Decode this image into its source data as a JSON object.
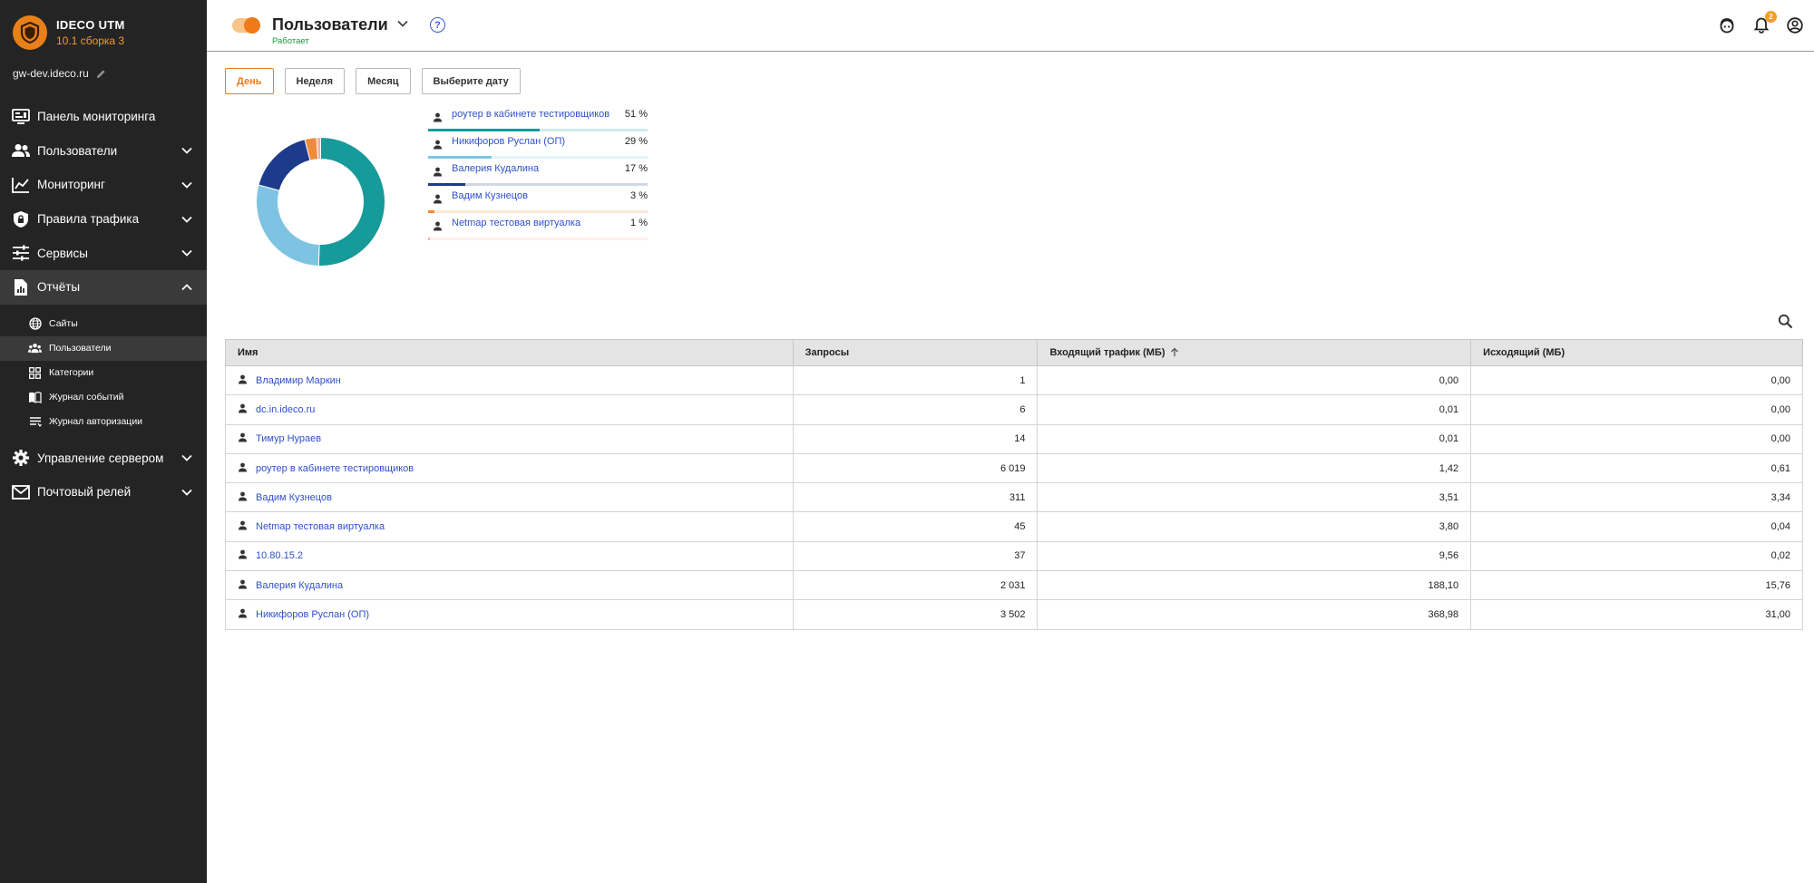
{
  "app": {
    "name": "IDECO UTM",
    "version": "10.1 сборка 3",
    "host": "gw-dev.ideco.ru"
  },
  "nav": {
    "items": [
      {
        "label": "Панель мониторинга",
        "icon": "monitoring-panel-icon"
      },
      {
        "label": "Пользователи",
        "icon": "users-icon"
      },
      {
        "label": "Мониторинг",
        "icon": "chart-line-icon"
      },
      {
        "label": "Правила трафика",
        "icon": "shield-lock-icon"
      },
      {
        "label": "Сервисы",
        "icon": "sliders-icon"
      },
      {
        "label": "Отчёты",
        "icon": "report-icon"
      },
      {
        "label": "Управление сервером",
        "icon": "gear-icon"
      },
      {
        "label": "Почтовый релей",
        "icon": "mail-icon"
      }
    ],
    "reports_sub": [
      {
        "label": "Сайты",
        "icon": "globe-icon"
      },
      {
        "label": "Пользователи",
        "icon": "users-icon"
      },
      {
        "label": "Категории",
        "icon": "grid-icon"
      },
      {
        "label": "Журнал событий",
        "icon": "book-icon"
      },
      {
        "label": "Журнал авторизации",
        "icon": "list-icon"
      }
    ]
  },
  "header": {
    "title": "Пользователи",
    "status": "Работает",
    "help": "?",
    "notifications_count": "2"
  },
  "periods": {
    "day": "День",
    "week": "Неделя",
    "month": "Месяц",
    "pick_date": "Выберите дату",
    "selected": "День"
  },
  "chart_data": {
    "type": "pie",
    "categories": [
      "роутер в кабинете тестировщиков",
      "Никифоров Руслан (ОП)",
      "Валерия Кудалина",
      "Вадим Кузнецов",
      "Netmap тестовая виртуалка"
    ],
    "values": [
      51,
      29,
      17,
      3,
      1
    ],
    "labels": [
      "51 %",
      "29 %",
      "17 %",
      "3 %",
      "1 %"
    ],
    "colors": [
      "#169a9a",
      "#7ec4e2",
      "#1e3a8a",
      "#f08a3c",
      "#f4b0a0"
    ]
  },
  "table": {
    "columns": [
      "Имя",
      "Запросы",
      "Входящий трафик (МБ)",
      "Исходящий (МБ)"
    ],
    "rows": [
      {
        "name": "Владимир Маркин",
        "requests": "1",
        "in": "0,00",
        "out": "0,00"
      },
      {
        "name": "dc.in.ideco.ru",
        "requests": "6",
        "in": "0,01",
        "out": "0,00"
      },
      {
        "name": "Тимур Нураев",
        "requests": "14",
        "in": "0,01",
        "out": "0,00"
      },
      {
        "name": "роутер в кабинете тестировщиков",
        "requests": "6 019",
        "in": "1,42",
        "out": "0,61"
      },
      {
        "name": "Вадим Кузнецов",
        "requests": "311",
        "in": "3,51",
        "out": "3,34"
      },
      {
        "name": "Netmap тестовая виртуалка",
        "requests": "45",
        "in": "3,80",
        "out": "0,04"
      },
      {
        "name": "10.80.15.2",
        "requests": "37",
        "in": "9,56",
        "out": "0,02"
      },
      {
        "name": "Валерия Кудалина",
        "requests": "2 031",
        "in": "188,10",
        "out": "15,76"
      },
      {
        "name": "Никифоров Руслан (ОП)",
        "requests": "3 502",
        "in": "368,98",
        "out": "31,00"
      }
    ]
  }
}
